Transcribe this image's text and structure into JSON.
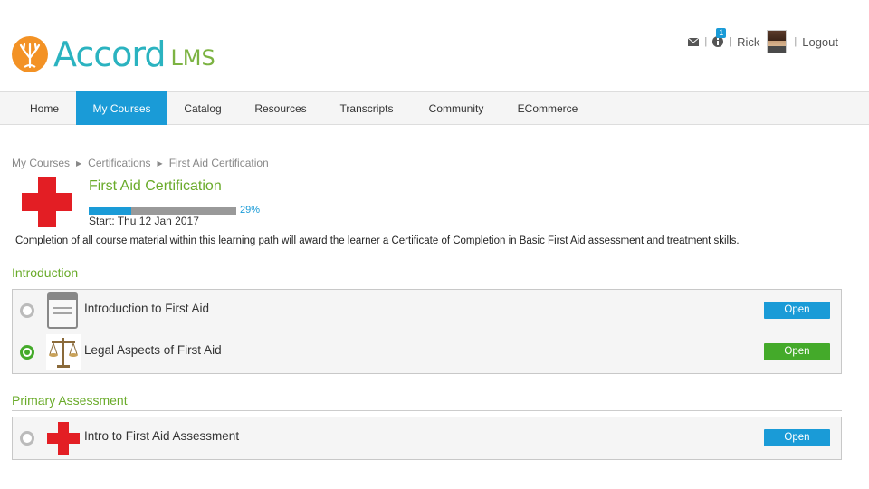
{
  "brand": {
    "name": "Accord",
    "suffix": "LMS"
  },
  "header": {
    "notification_count": "1",
    "username": "Rick",
    "logout_label": "Logout",
    "separator": "|"
  },
  "nav": {
    "items": [
      {
        "label": "Home",
        "active": false
      },
      {
        "label": "My Courses",
        "active": true
      },
      {
        "label": "Catalog",
        "active": false
      },
      {
        "label": "Resources",
        "active": false
      },
      {
        "label": "Transcripts",
        "active": false
      },
      {
        "label": "Community",
        "active": false
      },
      {
        "label": "ECommerce",
        "active": false
      }
    ]
  },
  "breadcrumb": [
    "My Courses",
    "Certifications",
    "First Aid Certification"
  ],
  "course": {
    "title": "First Aid Certification",
    "progress_percent": 29,
    "progress_label": "29%",
    "start": "Start: Thu 12 Jan 2017",
    "description": "Completion of all course material within this learning path will award the learner a Certificate of Completion in Basic First Aid assessment and treatment skills.",
    "icon": "red-cross-icon"
  },
  "sections": [
    {
      "title": "Introduction",
      "items": [
        {
          "label": "Introduction to First Aid",
          "status": "not-started",
          "icon": "book-icon",
          "button": "Open",
          "button_color": "#1a9bd7"
        },
        {
          "label": "Legal Aspects of First Aid",
          "status": "completed",
          "icon": "scales-icon",
          "button": "Open",
          "button_color": "#44aa2a"
        }
      ]
    },
    {
      "title": "Primary Assessment",
      "items": [
        {
          "label": "Intro to First Aid Assessment",
          "status": "not-started",
          "icon": "red-cross-icon",
          "button": "Open",
          "button_color": "#1a9bd7"
        }
      ]
    }
  ],
  "colors": {
    "accent": "#1a9bd7",
    "green": "#6aab2a",
    "complete": "#44aa2a",
    "cross": "#e31e24",
    "logo_orange": "#f39225",
    "logo_teal": "#2bb3c0"
  }
}
